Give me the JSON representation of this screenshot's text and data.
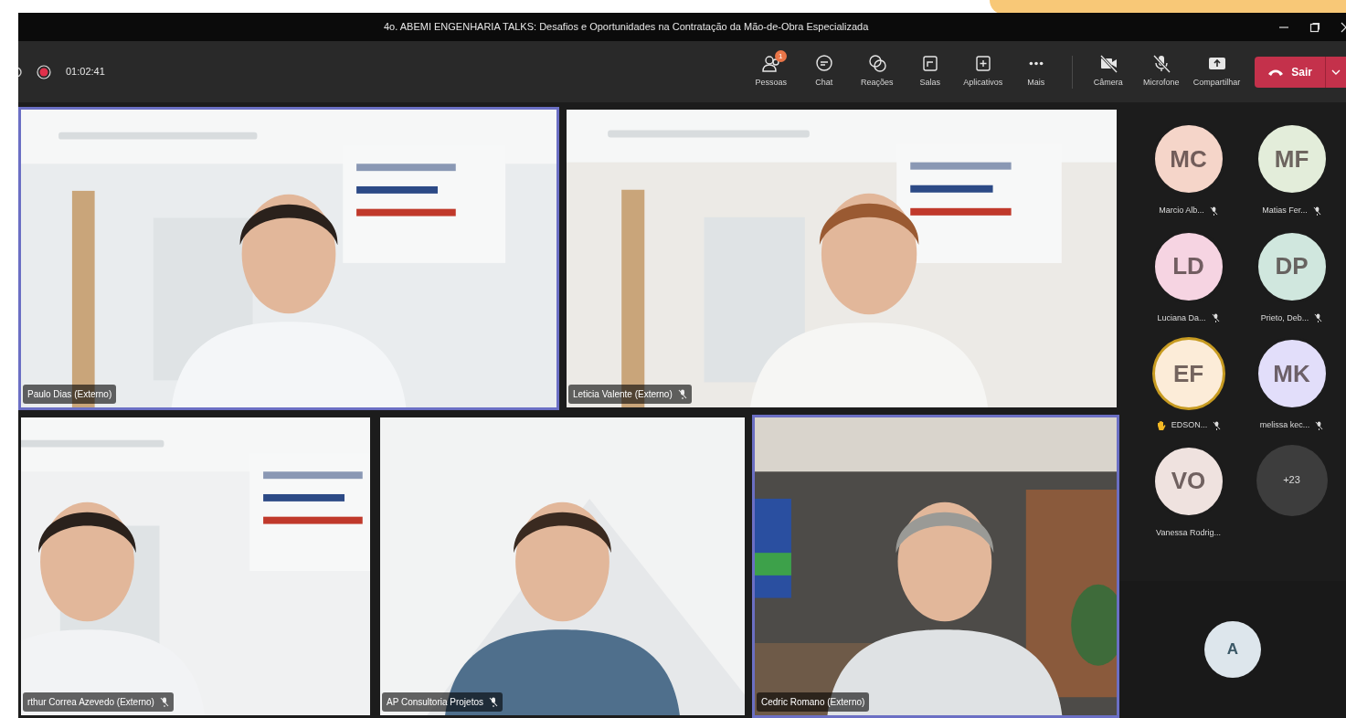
{
  "window": {
    "title": "4o. ABEMI ENGENHARIA TALKS: Desafios e Oportunidades na Contratação da Mão-de-Obra Especializada"
  },
  "toolbar": {
    "recording": true,
    "timer": "01:02:41",
    "buttons": [
      {
        "kind": "people",
        "label": "Pessoas",
        "badge": "1"
      },
      {
        "kind": "chat",
        "label": "Chat"
      },
      {
        "kind": "reactions",
        "label": "Reações"
      },
      {
        "kind": "rooms",
        "label": "Salas"
      },
      {
        "kind": "apps",
        "label": "Aplicativos"
      },
      {
        "kind": "more",
        "label": "Mais"
      },
      {
        "kind": "camera",
        "label": "Câmera",
        "on": false
      },
      {
        "kind": "mic",
        "label": "Microfone",
        "on": false
      },
      {
        "kind": "share",
        "label": "Compartilhar"
      }
    ],
    "leave": {
      "label": "Sair"
    }
  },
  "video_rows": [
    [
      {
        "name": "Paulo Dias (Externo)",
        "muted": false,
        "speaking": true
      },
      {
        "name": "Leticia Valente (Externo)",
        "muted": true,
        "speaking": false
      }
    ],
    [
      {
        "name": "rthur Correa Azevedo (Externo)",
        "muted": true,
        "speaking": false
      },
      {
        "name": "AP Consultoria Projetos",
        "muted": true,
        "speaking": false
      },
      {
        "name": "Cedric Romano (Externo)",
        "muted": false,
        "speaking": true
      }
    ]
  ],
  "roster": [
    {
      "kind": "person",
      "initials": "MC",
      "name": "Marcio Alb...",
      "muted": true,
      "speaking": false,
      "hand_raised": false,
      "color": "#f5d5c9"
    },
    {
      "kind": "person",
      "initials": "MF",
      "name": "Matias Fer...",
      "muted": true,
      "speaking": false,
      "hand_raised": false,
      "color": "#e3edda"
    },
    {
      "kind": "person",
      "initials": "LD",
      "name": "Luciana Da...",
      "muted": true,
      "speaking": false,
      "hand_raised": false,
      "color": "#f6d4e2"
    },
    {
      "kind": "person",
      "initials": "DP",
      "name": "Prieto, Deb...",
      "muted": true,
      "speaking": false,
      "hand_raised": false,
      "color": "#d0e7de"
    },
    {
      "kind": "person",
      "initials": "EF",
      "name": "EDSON...",
      "muted": true,
      "speaking": true,
      "hand_raised": true,
      "color": "#fcecd8"
    },
    {
      "kind": "person",
      "initials": "MK",
      "name": "melissa kec...",
      "muted": true,
      "speaking": false,
      "hand_raised": false,
      "color": "#e2defa"
    },
    {
      "kind": "person",
      "initials": "VO",
      "name": "Vanessa Rodrig...",
      "muted": false,
      "speaking": false,
      "hand_raised": false,
      "color": "#efe2df"
    },
    {
      "kind": "overflow",
      "initials": "+23"
    }
  ],
  "self_view": {
    "initials": "A"
  }
}
